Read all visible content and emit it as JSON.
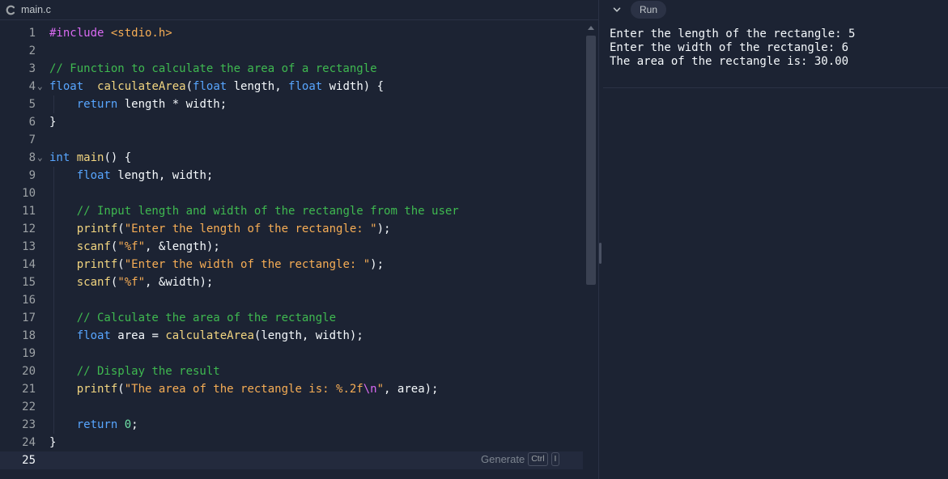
{
  "tab": {
    "filename": "main.c",
    "icon": "c-language-icon"
  },
  "console": {
    "run_label": "Run",
    "output": [
      "Enter the length of the rectangle: 5",
      "Enter the width of the rectangle: 6",
      "The area of the rectangle is: 30.00"
    ]
  },
  "editor": {
    "active_line": 25,
    "generate_hint": {
      "label": "Generate",
      "key1": "Ctrl",
      "key2": "I"
    },
    "lines": [
      {
        "n": "1",
        "fold": false,
        "tokens": [
          [
            "pp",
            "#include "
          ],
          [
            "ppv",
            "<stdio.h>"
          ]
        ]
      },
      {
        "n": "2",
        "fold": false,
        "tokens": []
      },
      {
        "n": "3",
        "fold": false,
        "tokens": [
          [
            "cm",
            "// Function to calculate the area of a rectangle"
          ]
        ]
      },
      {
        "n": "4",
        "fold": true,
        "tokens": [
          [
            "kw",
            "float"
          ],
          [
            "",
            "  "
          ],
          [
            "fn",
            "calculateArea"
          ],
          [
            "",
            "("
          ],
          [
            "kw",
            "float"
          ],
          [
            "",
            " length, "
          ],
          [
            "kw",
            "float"
          ],
          [
            "",
            " width) {"
          ]
        ]
      },
      {
        "n": "5",
        "fold": false,
        "tokens": [
          [
            "",
            "    "
          ],
          [
            "kw",
            "return"
          ],
          [
            "",
            " length * width;"
          ]
        ]
      },
      {
        "n": "6",
        "fold": false,
        "tokens": [
          [
            "",
            "}"
          ]
        ]
      },
      {
        "n": "7",
        "fold": false,
        "tokens": []
      },
      {
        "n": "8",
        "fold": true,
        "tokens": [
          [
            "kw",
            "int"
          ],
          [
            " ",
            " "
          ],
          [
            "fn",
            "main"
          ],
          [
            "",
            "() {"
          ]
        ]
      },
      {
        "n": "9",
        "fold": false,
        "tokens": [
          [
            "",
            "    "
          ],
          [
            "kw",
            "float"
          ],
          [
            "",
            " length, width;"
          ]
        ]
      },
      {
        "n": "10",
        "fold": false,
        "tokens": []
      },
      {
        "n": "11",
        "fold": false,
        "tokens": [
          [
            "",
            "    "
          ],
          [
            "cm",
            "// Input length and width of the rectangle from the user"
          ]
        ]
      },
      {
        "n": "12",
        "fold": false,
        "tokens": [
          [
            "",
            "    "
          ],
          [
            "fn",
            "printf"
          ],
          [
            "",
            "("
          ],
          [
            "str",
            "\"Enter the length of the rectangle: \""
          ],
          [
            "",
            ");"
          ]
        ]
      },
      {
        "n": "13",
        "fold": false,
        "tokens": [
          [
            "",
            "    "
          ],
          [
            "fn",
            "scanf"
          ],
          [
            "",
            "("
          ],
          [
            "str",
            "\"%f\""
          ],
          [
            "",
            ", &length);"
          ]
        ]
      },
      {
        "n": "14",
        "fold": false,
        "tokens": [
          [
            "",
            "    "
          ],
          [
            "fn",
            "printf"
          ],
          [
            "",
            "("
          ],
          [
            "str",
            "\"Enter the width of the rectangle: \""
          ],
          [
            "",
            ");"
          ]
        ]
      },
      {
        "n": "15",
        "fold": false,
        "tokens": [
          [
            "",
            "    "
          ],
          [
            "fn",
            "scanf"
          ],
          [
            "",
            "("
          ],
          [
            "str",
            "\"%f\""
          ],
          [
            "",
            ", &width);"
          ]
        ]
      },
      {
        "n": "16",
        "fold": false,
        "tokens": []
      },
      {
        "n": "17",
        "fold": false,
        "tokens": [
          [
            "",
            "    "
          ],
          [
            "cm",
            "// Calculate the area of the rectangle"
          ]
        ]
      },
      {
        "n": "18",
        "fold": false,
        "tokens": [
          [
            "",
            "    "
          ],
          [
            "kw",
            "float"
          ],
          [
            "",
            " area = "
          ],
          [
            "fn",
            "calculateArea"
          ],
          [
            "",
            "(length, width);"
          ]
        ]
      },
      {
        "n": "19",
        "fold": false,
        "tokens": []
      },
      {
        "n": "20",
        "fold": false,
        "tokens": [
          [
            "",
            "    "
          ],
          [
            "cm",
            "// Display the result"
          ]
        ]
      },
      {
        "n": "21",
        "fold": false,
        "tokens": [
          [
            "",
            "    "
          ],
          [
            "fn",
            "printf"
          ],
          [
            "",
            "("
          ],
          [
            "str",
            "\"The area of the rectangle is: %.2f"
          ],
          [
            "esc",
            "\\n"
          ],
          [
            "str",
            "\""
          ],
          [
            "",
            ", area);"
          ]
        ]
      },
      {
        "n": "22",
        "fold": false,
        "tokens": []
      },
      {
        "n": "23",
        "fold": false,
        "tokens": [
          [
            "",
            "    "
          ],
          [
            "kw",
            "return"
          ],
          [
            "",
            " "
          ],
          [
            "num",
            "0"
          ],
          [
            "",
            ";"
          ]
        ]
      },
      {
        "n": "24",
        "fold": false,
        "tokens": [
          [
            "",
            "}"
          ]
        ]
      },
      {
        "n": "25",
        "fold": false,
        "tokens": []
      }
    ]
  }
}
